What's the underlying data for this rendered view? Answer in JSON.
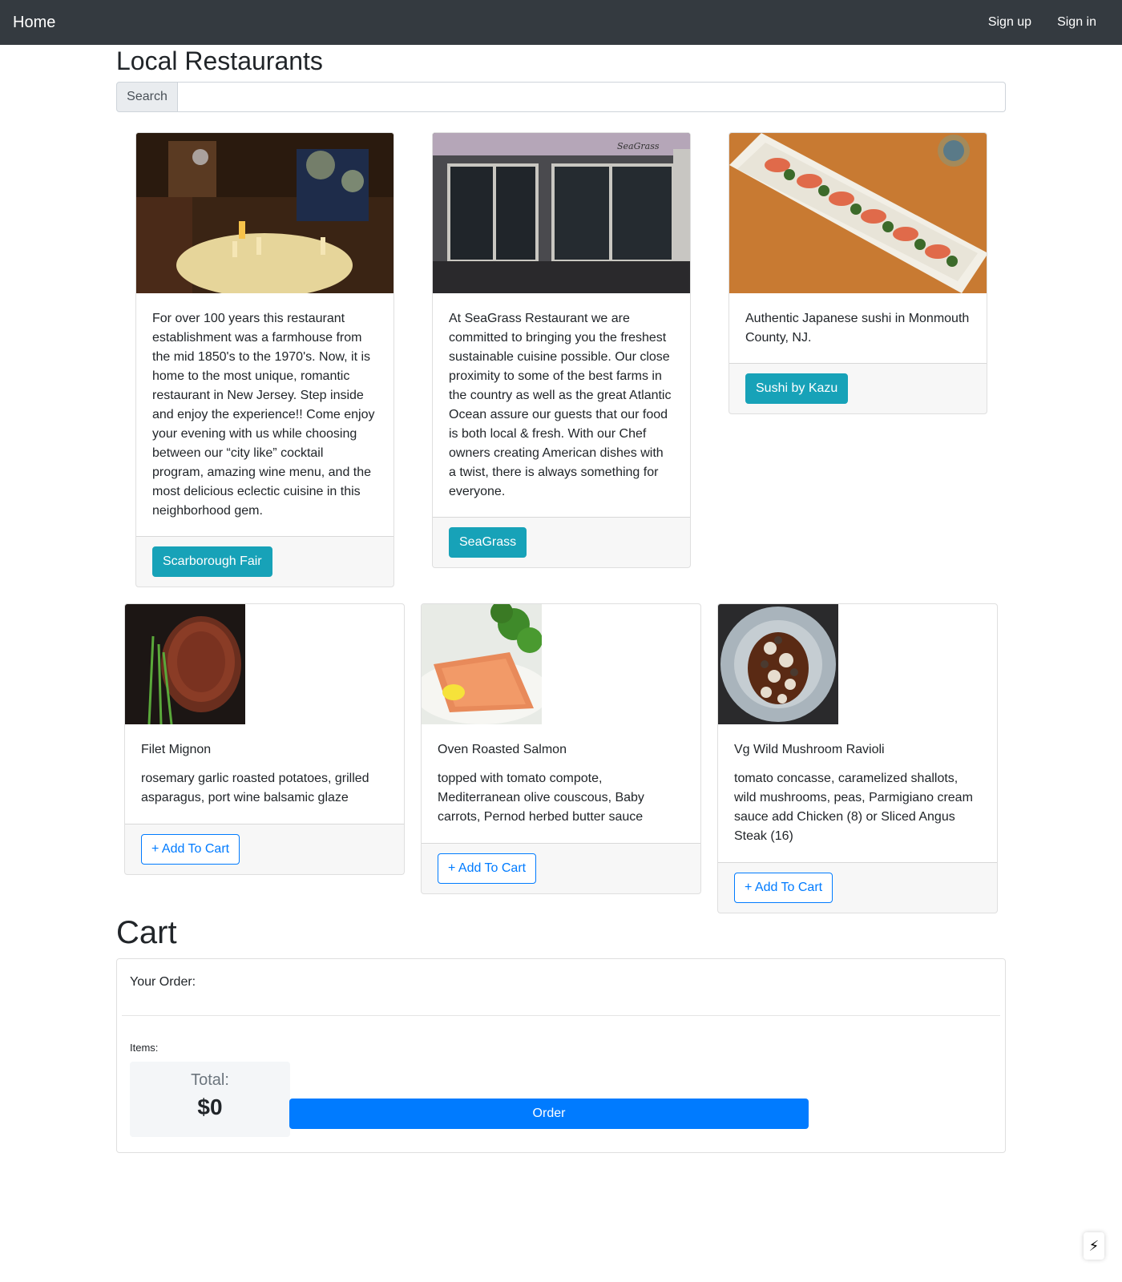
{
  "navbar": {
    "home": "Home",
    "sign_up": "Sign up",
    "sign_in": "Sign in"
  },
  "page": {
    "title": "Local Restaurants",
    "search_label": "Search",
    "search_value": ""
  },
  "restaurants": [
    {
      "image": "restaurant-interior-photo",
      "description": "For over 100 years this restaurant establishment was a farmhouse from the mid 1850's to the 1970's. Now, it is home to the most unique, romantic restaurant in New Jersey. Step inside and enjoy the experience!! Come enjoy your evening with us while choosing between our “city like” cocktail program, amazing wine menu, and the most delicious eclectic cuisine in this neighborhood gem.",
      "button": "Scarborough Fair"
    },
    {
      "image": "restaurant-storefront-photo",
      "description": "At SeaGrass Restaurant we are committed to bringing you the freshest sustainable cuisine possible. Our close proximity to some of the best farms in the country as well as the great Atlantic Ocean assure our guests that our food is both local & fresh. With our Chef owners creating American dishes with a twist, there is always something for everyone.",
      "button": "SeaGrass"
    },
    {
      "image": "sushi-plate-photo",
      "description": "Authentic Japanese sushi in Monmouth County, NJ.",
      "button": "Sushi by Kazu"
    }
  ],
  "menu_items": [
    {
      "image": "steak-photo",
      "name": "Filet Mignon",
      "description": "rosemary garlic roasted potatoes, grilled asparagus, port wine balsamic glaze",
      "button": "+ Add To Cart"
    },
    {
      "image": "salmon-photo",
      "name": "Oven Roasted Salmon",
      "description": "topped with tomato compote, Mediterranean olive couscous, Baby carrots, Pernod herbed butter sauce",
      "button": "+ Add To Cart"
    },
    {
      "image": "ravioli-photo",
      "name": "Vg Wild Mushroom Ravioli",
      "description": "tomato concasse, caramelized shallots, wild mushrooms, peas, Parmigiano cream sauce add Chicken (8) or Sliced Angus Steak (16)",
      "button": "+ Add To Cart"
    }
  ],
  "cart": {
    "title": "Cart",
    "your_order": "Your Order:",
    "items_label": "Items:",
    "total_label": "Total:",
    "total_value": "$0",
    "order_button": "Order"
  },
  "colors": {
    "navbar": "#343a40",
    "info": "#17a2b8",
    "primary": "#007bff"
  }
}
